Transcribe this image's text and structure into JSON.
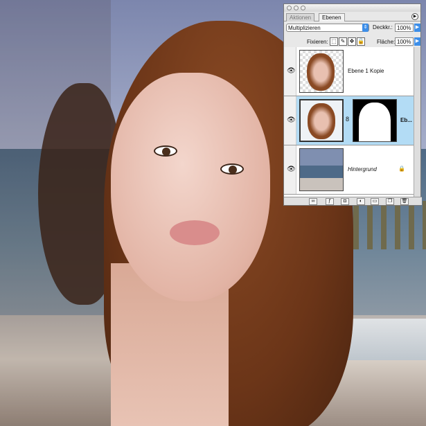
{
  "panel": {
    "tabs": [
      {
        "label": "Aktionen"
      },
      {
        "label": "Ebenen"
      }
    ],
    "blend_mode": "Multiplizieren",
    "opacity_label": "Deckkr.:",
    "opacity_value": "100%",
    "lock_label": "Fixieren:",
    "fill_label": "Fläche:",
    "fill_value": "100%",
    "layers": [
      {
        "name": "Ebene 1 Kopie",
        "visible": true,
        "selected": false
      },
      {
        "name": "Eb...",
        "visible": true,
        "selected": true,
        "has_mask": true
      },
      {
        "name": "Hintergrund",
        "visible": true,
        "selected": false,
        "locked": true
      }
    ],
    "selected_color": "#b3dcf5"
  }
}
